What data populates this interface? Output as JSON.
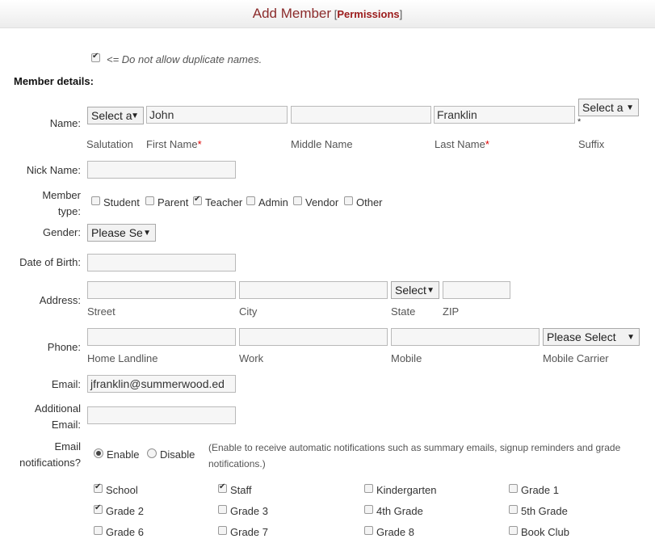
{
  "header": {
    "title": "Add Member",
    "permissions": "Permissions",
    "bracket_open": "[",
    "bracket_close": "]"
  },
  "duplicate_names": {
    "label": "<= Do not allow duplicate names.",
    "checked": true
  },
  "section_title": "Member details:",
  "name": {
    "label": "Name:",
    "salutation": {
      "value": "Select a",
      "caption": "Salutation"
    },
    "first": {
      "value": "John",
      "caption": "First Name",
      "required_mark": "*"
    },
    "middle": {
      "value": "",
      "caption": "Middle Name"
    },
    "last": {
      "value": "Franklin",
      "caption": "Last Name",
      "required_mark": "*"
    },
    "suffix": {
      "value": "Select a",
      "caption": "Suffix",
      "required_mark": "*"
    }
  },
  "nick_name": {
    "label": "Nick Name:",
    "value": ""
  },
  "member_type": {
    "label_line1": "Member",
    "label_line2": "type:",
    "options": [
      {
        "label": "Student",
        "checked": false
      },
      {
        "label": "Parent",
        "checked": false
      },
      {
        "label": "Teacher",
        "checked": true
      },
      {
        "label": "Admin",
        "checked": false
      },
      {
        "label": "Vendor",
        "checked": false
      },
      {
        "label": "Other",
        "checked": false
      }
    ]
  },
  "gender": {
    "label": "Gender:",
    "value": "Please Se"
  },
  "dob": {
    "label": "Date of Birth:",
    "value": ""
  },
  "address": {
    "label": "Address:",
    "street": {
      "value": "",
      "caption": "Street"
    },
    "city": {
      "value": "",
      "caption": "City"
    },
    "state": {
      "value": "Select",
      "caption": "State"
    },
    "zip": {
      "value": "",
      "caption": "ZIP"
    }
  },
  "phone": {
    "label": "Phone:",
    "home": {
      "value": "",
      "caption": "Home Landline"
    },
    "work": {
      "value": "",
      "caption": "Work"
    },
    "mobile": {
      "value": "",
      "caption": "Mobile"
    },
    "carrier": {
      "value": "Please Select",
      "caption": "Mobile Carrier"
    }
  },
  "email": {
    "label": "Email:",
    "value": "jfranklin@summerwood.ed"
  },
  "additional_email": {
    "label_line1": "Additional",
    "label_line2": "Email:",
    "value": ""
  },
  "notifications": {
    "label_line1": "Email",
    "label_line2": "notifications?",
    "enable": {
      "label": "Enable",
      "selected": true
    },
    "disable": {
      "label": "Disable",
      "selected": false
    },
    "note_line1": "(Enable to receive automatic notifications such as summary emails, signup reminders and grade",
    "note_line2": "notifications.)"
  },
  "groups": [
    {
      "label": "School",
      "checked": true
    },
    {
      "label": "Staff",
      "checked": true
    },
    {
      "label": "Kindergarten",
      "checked": false
    },
    {
      "label": "Grade 1",
      "checked": false
    },
    {
      "label": "Grade 2",
      "checked": true
    },
    {
      "label": "Grade 3",
      "checked": false
    },
    {
      "label": "4th Grade",
      "checked": false
    },
    {
      "label": "5th Grade",
      "checked": false
    },
    {
      "label": "Grade 6",
      "checked": false
    },
    {
      "label": "Grade 7",
      "checked": false
    },
    {
      "label": "Grade 8",
      "checked": false
    },
    {
      "label": "Book Club",
      "checked": false
    }
  ]
}
